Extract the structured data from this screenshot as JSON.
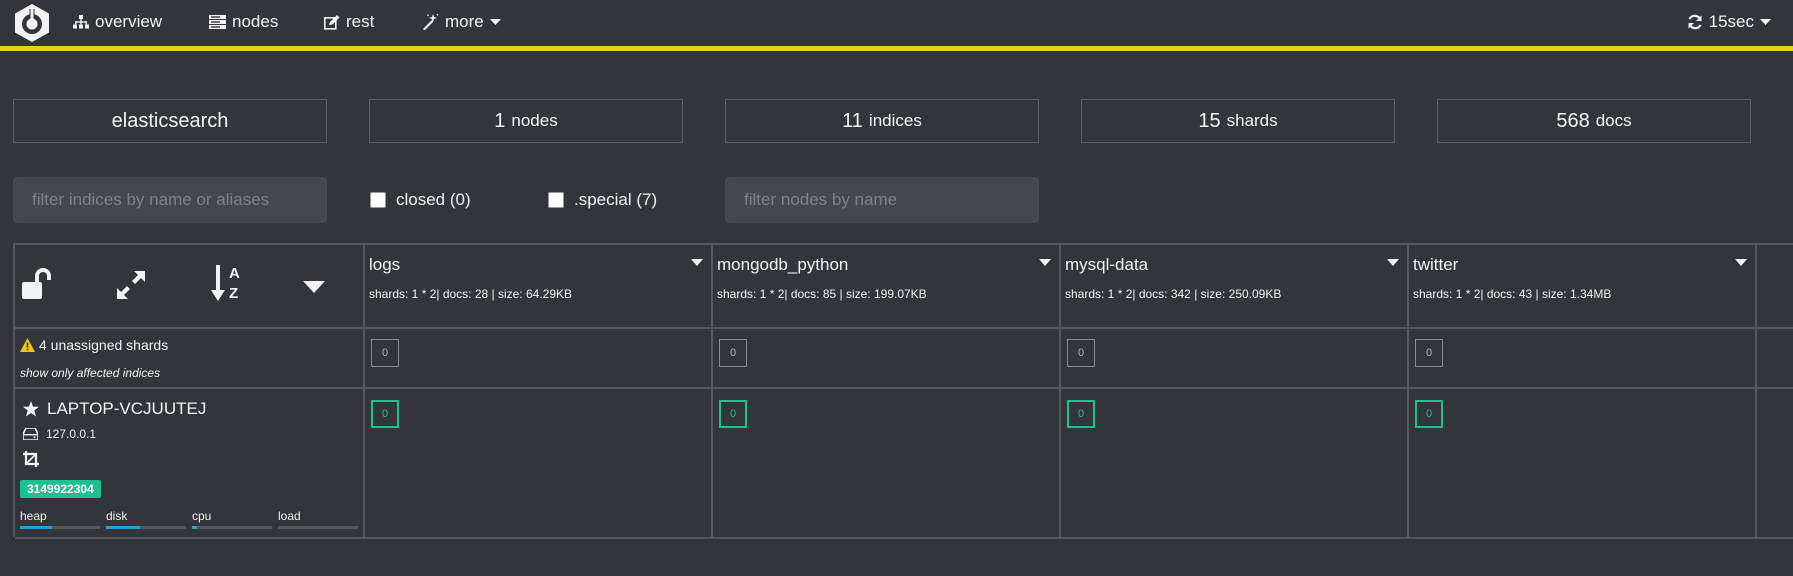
{
  "nav": {
    "overview": "overview",
    "nodes": "nodes",
    "rest": "rest",
    "more": "more",
    "refresh": "15sec"
  },
  "summary": {
    "cluster_name": "elasticsearch",
    "nodes_count": "1",
    "nodes_unit": "nodes",
    "indices_count": "11",
    "indices_unit": "indices",
    "shards_count": "15",
    "shards_unit": "shards",
    "docs_count": "568",
    "docs_unit": "docs"
  },
  "filters": {
    "indices_placeholder": "filter indices by name or aliases",
    "closed_label": "closed (0)",
    "special_label": ".special (7)",
    "nodes_placeholder": "filter nodes by name"
  },
  "indices": [
    {
      "name": "logs",
      "meta": "shards: 1 * 2| docs: 28 | size: 64.29KB",
      "unassigned": "0",
      "shard": "0"
    },
    {
      "name": "mongodb_python",
      "meta": "shards: 1 * 2| docs: 85 | size: 199.07KB",
      "unassigned": "0",
      "shard": "0"
    },
    {
      "name": "mysql-data",
      "meta": "shards: 1 * 2| docs: 342 | size: 250.09KB",
      "unassigned": "0",
      "shard": "0"
    },
    {
      "name": "twitter",
      "meta": "shards: 1 * 2| docs: 43 | size: 1.34MB",
      "unassigned": "0",
      "shard": "0"
    }
  ],
  "unassigned": {
    "label": "4 unassigned shards",
    "affected": "show only affected indices"
  },
  "node": {
    "name": "LAPTOP-VCJUUTEJ",
    "ip": "127.0.0.1",
    "badge": "3149922304",
    "meters": [
      {
        "label": "heap",
        "value": 0.4
      },
      {
        "label": "disk",
        "value": 0.42
      },
      {
        "label": "cpu",
        "value": 0.06
      },
      {
        "label": "load",
        "value": 0
      }
    ]
  },
  "colors": {
    "accent_bar": "#e6cf2a",
    "shard_green": "#1fc08f",
    "meter_blue": "#2a9fd6",
    "background": "#32363a"
  }
}
